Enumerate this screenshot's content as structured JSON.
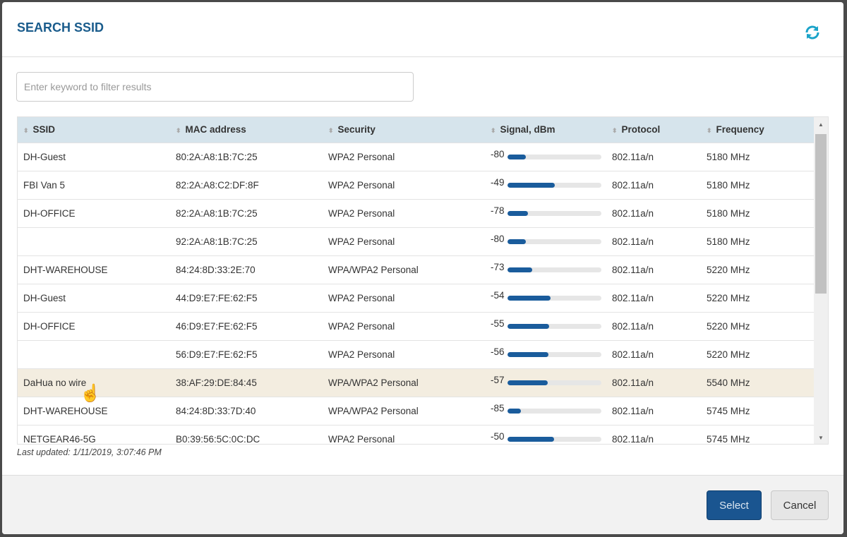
{
  "dialog": {
    "title": "SEARCH SSID",
    "refresh_icon": "refresh-icon"
  },
  "filter": {
    "placeholder": "Enter keyword to filter results",
    "value": ""
  },
  "table": {
    "columns": [
      "SSID",
      "MAC address",
      "Security",
      "Signal, dBm",
      "Protocol",
      "Frequency"
    ],
    "signal_range_dbm": [
      -100,
      0
    ],
    "rows": [
      {
        "ssid": "DH-Guest",
        "mac": "80:2A:A8:1B:7C:25",
        "security": "WPA2 Personal",
        "signal": "-80",
        "protocol": "802.11a/n",
        "frequency": "5180 MHz"
      },
      {
        "ssid": "FBI Van 5",
        "mac": "82:2A:A8:C2:DF:8F",
        "security": "WPA2 Personal",
        "signal": "-49",
        "protocol": "802.11a/n",
        "frequency": "5180 MHz"
      },
      {
        "ssid": "DH-OFFICE",
        "mac": "82:2A:A8:1B:7C:25",
        "security": "WPA2 Personal",
        "signal": "-78",
        "protocol": "802.11a/n",
        "frequency": "5180 MHz"
      },
      {
        "ssid": "",
        "mac": "92:2A:A8:1B:7C:25",
        "security": "WPA2 Personal",
        "signal": "-80",
        "protocol": "802.11a/n",
        "frequency": "5180 MHz"
      },
      {
        "ssid": "DHT-WAREHOUSE",
        "mac": "84:24:8D:33:2E:70",
        "security": "WPA/WPA2 Personal",
        "signal": "-73",
        "protocol": "802.11a/n",
        "frequency": "5220 MHz"
      },
      {
        "ssid": "DH-Guest",
        "mac": "44:D9:E7:FE:62:F5",
        "security": "WPA2 Personal",
        "signal": "-54",
        "protocol": "802.11a/n",
        "frequency": "5220 MHz"
      },
      {
        "ssid": "DH-OFFICE",
        "mac": "46:D9:E7:FE:62:F5",
        "security": "WPA2 Personal",
        "signal": "-55",
        "protocol": "802.11a/n",
        "frequency": "5220 MHz"
      },
      {
        "ssid": "",
        "mac": "56:D9:E7:FE:62:F5",
        "security": "WPA2 Personal",
        "signal": "-56",
        "protocol": "802.11a/n",
        "frequency": "5220 MHz"
      },
      {
        "ssid": "DaHua no wire",
        "mac": "38:AF:29:DE:84:45",
        "security": "WPA/WPA2 Personal",
        "signal": "-57",
        "protocol": "802.11a/n",
        "frequency": "5540 MHz",
        "highlighted": true
      },
      {
        "ssid": "DHT-WAREHOUSE",
        "mac": "84:24:8D:33:7D:40",
        "security": "WPA/WPA2 Personal",
        "signal": "-85",
        "protocol": "802.11a/n",
        "frequency": "5745 MHz"
      },
      {
        "ssid": "NETGEAR46-5G",
        "mac": "B0:39:56:5C:0C:DC",
        "security": "WPA2 Personal",
        "signal": "-50",
        "protocol": "802.11a/n",
        "frequency": "5745 MHz"
      }
    ]
  },
  "status": {
    "last_updated": "Last updated: 1/11/2019, 3:07:46 PM"
  },
  "footer": {
    "select_label": "Select",
    "cancel_label": "Cancel"
  },
  "colors": {
    "accent": "#1a5c8c",
    "signal_fill": "#1a5c9c",
    "refresh": "#1aa3c9",
    "highlight_row": "#f3ede0"
  }
}
